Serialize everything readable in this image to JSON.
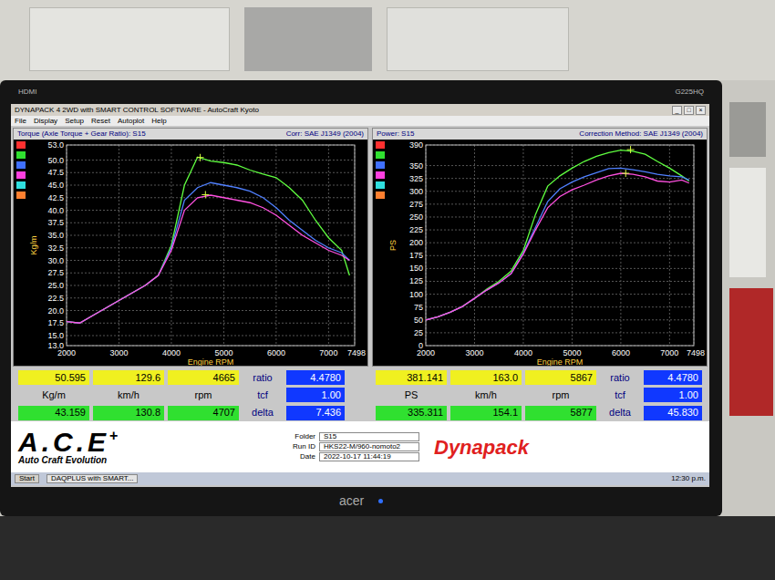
{
  "monitor": {
    "input": "HDMI",
    "model": "G225HQ",
    "brand": "acer"
  },
  "window": {
    "title": "DYNAPACK 4 2WD with SMART CONTROL SOFTWARE - AutoCraft Kyoto",
    "controls": [
      "_",
      "□",
      "×"
    ],
    "menu": [
      "File",
      "Display",
      "Setup",
      "Reset",
      "Autoplot",
      "Help"
    ]
  },
  "charts": [
    {
      "title": "Torque (Axle Torque + Gear Ratio): S15",
      "correction": "Corr: SAE J1349 (2004)",
      "y_label": "Kg/m",
      "x_label": "Engine RPM",
      "y_min": 13,
      "y_max": 53,
      "y_ticks": [
        "53.0",
        "50.0",
        "47.5",
        "45.0",
        "42.5",
        "40.0",
        "37.5",
        "35.0",
        "32.5",
        "30.0",
        "27.5",
        "25.0",
        "22.5",
        "20.0",
        "17.5",
        "15.0",
        "13.0"
      ],
      "x_ticks": [
        "2000",
        "3000",
        "4000",
        "5000",
        "6000",
        "7000",
        "7498"
      ],
      "swatches": [
        {
          "color": "#ff3030"
        },
        {
          "color": "#30e030"
        },
        {
          "color": "#4070ff"
        },
        {
          "color": "#ff40e0"
        },
        {
          "color": "#30e0e0"
        },
        {
          "color": "#ff8030"
        }
      ],
      "rpm": [
        2000,
        2250,
        2500,
        2750,
        3000,
        3250,
        3500,
        3750,
        4000,
        4250,
        4500,
        4750,
        5000,
        5250,
        5500,
        5750,
        6000,
        6250,
        6500,
        6750,
        7000,
        7250,
        7400
      ],
      "series": [
        {
          "color": "#60ff40",
          "values": [
            17.8,
            17.5,
            19,
            20.5,
            22,
            23.5,
            25,
            27,
            33,
            45,
            50.6,
            49.8,
            49.5,
            49,
            48,
            47.2,
            46.5,
            44.5,
            42,
            38,
            34.5,
            32,
            27
          ]
        },
        {
          "color": "#5080ff",
          "values": [
            17.8,
            17.5,
            19,
            20.5,
            22,
            23.5,
            25,
            27,
            32.5,
            42,
            44.5,
            45.5,
            45,
            44.5,
            43.8,
            42.5,
            40.5,
            38,
            36,
            34,
            32.5,
            31.5,
            30
          ]
        },
        {
          "color": "#ff50e0",
          "values": [
            17.8,
            17.5,
            19,
            20.5,
            22,
            23.5,
            25,
            27,
            32,
            40,
            42.5,
            43,
            42.5,
            42,
            41.5,
            40.5,
            39,
            37,
            35,
            33.5,
            32,
            31,
            30
          ]
        }
      ],
      "cursors": [
        {
          "rpm": 4550,
          "value": 50.5,
          "color": "#d8ff40"
        },
        {
          "rpm": 4650,
          "value": 43.1,
          "color": "#d8ff40"
        }
      ]
    },
    {
      "title": "Power: S15",
      "correction": "Correction Method: SAE J1349 (2004)",
      "y_label": "PS",
      "x_label": "Engine RPM",
      "y_min": 0,
      "y_max": 390,
      "y_ticks": [
        "390",
        "350",
        "325",
        "300",
        "275",
        "250",
        "225",
        "200",
        "175",
        "150",
        "125",
        "100",
        "75",
        "50",
        "25",
        "0"
      ],
      "x_ticks": [
        "2000",
        "3000",
        "4000",
        "5000",
        "6000",
        "7000",
        "7498"
      ],
      "swatches": [
        {
          "color": "#ff3030"
        },
        {
          "color": "#30e030"
        },
        {
          "color": "#4070ff"
        },
        {
          "color": "#ff40e0"
        },
        {
          "color": "#30e0e0"
        },
        {
          "color": "#ff8030"
        }
      ],
      "rpm": [
        2000,
        2250,
        2500,
        2750,
        3000,
        3250,
        3500,
        3750,
        4000,
        4250,
        4500,
        4750,
        5000,
        5250,
        5500,
        5750,
        6000,
        6250,
        6500,
        6750,
        7000,
        7250,
        7400
      ],
      "series": [
        {
          "color": "#60ff40",
          "values": [
            50,
            56,
            65,
            76,
            92,
            110,
            125,
            145,
            185,
            255,
            310,
            330,
            345,
            358,
            368,
            375,
            380,
            378,
            372,
            358,
            345,
            330,
            320
          ]
        },
        {
          "color": "#5080ff",
          "values": [
            50,
            56,
            65,
            76,
            92,
            108,
            122,
            140,
            180,
            230,
            280,
            305,
            318,
            328,
            336,
            344,
            345,
            342,
            338,
            333,
            330,
            328,
            322
          ]
        },
        {
          "color": "#ff50e0",
          "values": [
            50,
            56,
            65,
            76,
            92,
            108,
            122,
            140,
            178,
            225,
            268,
            290,
            303,
            312,
            322,
            330,
            335,
            333,
            328,
            320,
            318,
            322,
            316
          ]
        }
      ],
      "cursors": [
        {
          "rpm": 6200,
          "value": 381,
          "color": "#d8ff40"
        },
        {
          "rpm": 6100,
          "value": 335,
          "color": "#d8ff40"
        }
      ]
    }
  ],
  "readouts": [
    {
      "top": [
        "50.595",
        "129.6",
        "4665"
      ],
      "units": [
        "Kg/m",
        "km/h",
        "rpm"
      ],
      "bottom": [
        "43.159",
        "130.8",
        "4707"
      ],
      "params": [
        {
          "label": "ratio",
          "value": "4.4780"
        },
        {
          "label": "tcf",
          "value": "1.00"
        },
        {
          "label": "delta",
          "value": "7.436"
        }
      ]
    },
    {
      "top": [
        "381.141",
        "163.0",
        "5867"
      ],
      "units": [
        "PS",
        "km/h",
        "rpm"
      ],
      "bottom": [
        "335.311",
        "154.1",
        "5877"
      ],
      "params": [
        {
          "label": "ratio",
          "value": "4.4780"
        },
        {
          "label": "tcf",
          "value": "1.00"
        },
        {
          "label": "delta",
          "value": "45.830"
        }
      ]
    }
  ],
  "footer": {
    "logo": "A.C.E",
    "logo_plus": "+",
    "subtitle": "Auto Craft Evolution",
    "run_info": [
      {
        "label": "Folder",
        "value": "S15"
      },
      {
        "label": "Run ID",
        "value": "HKS22-M/960-nomoto2"
      },
      {
        "label": "Date",
        "value": "2022-10-17 11:44:19"
      }
    ],
    "brand": "Dynapack"
  },
  "taskbar": {
    "start": "Start",
    "tasks": [
      "DAQPLUS with SMART..."
    ],
    "clock": "12:30 p.m."
  }
}
